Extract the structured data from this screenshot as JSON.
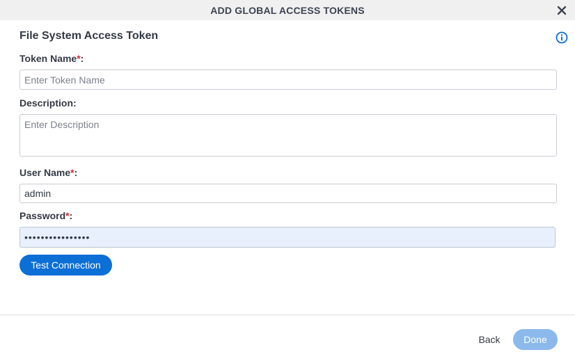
{
  "dialog": {
    "title": "ADD GLOBAL ACCESS TOKENS",
    "close_icon": "close-icon"
  },
  "form": {
    "section_title": "File System Access Token",
    "info_icon": "info-icon",
    "required_mark": "*",
    "token_name": {
      "label": "Token Name",
      "suffix": ":",
      "placeholder": "Enter Token Name",
      "value": ""
    },
    "description": {
      "label": "Description:",
      "placeholder": "Enter Description",
      "value": ""
    },
    "user_name": {
      "label": "User Name",
      "suffix": ":",
      "value": "admin"
    },
    "password": {
      "label": "Password",
      "suffix": ":",
      "value": "••••••••••••••••"
    },
    "test_connection_label": "Test Connection"
  },
  "footer": {
    "back_label": "Back",
    "done_label": "Done"
  },
  "colors": {
    "primary": "#0b6fd6",
    "primary_disabled": "#8cb9ec",
    "required": "#d9262f",
    "autofill_bg": "#e8f0fe"
  }
}
